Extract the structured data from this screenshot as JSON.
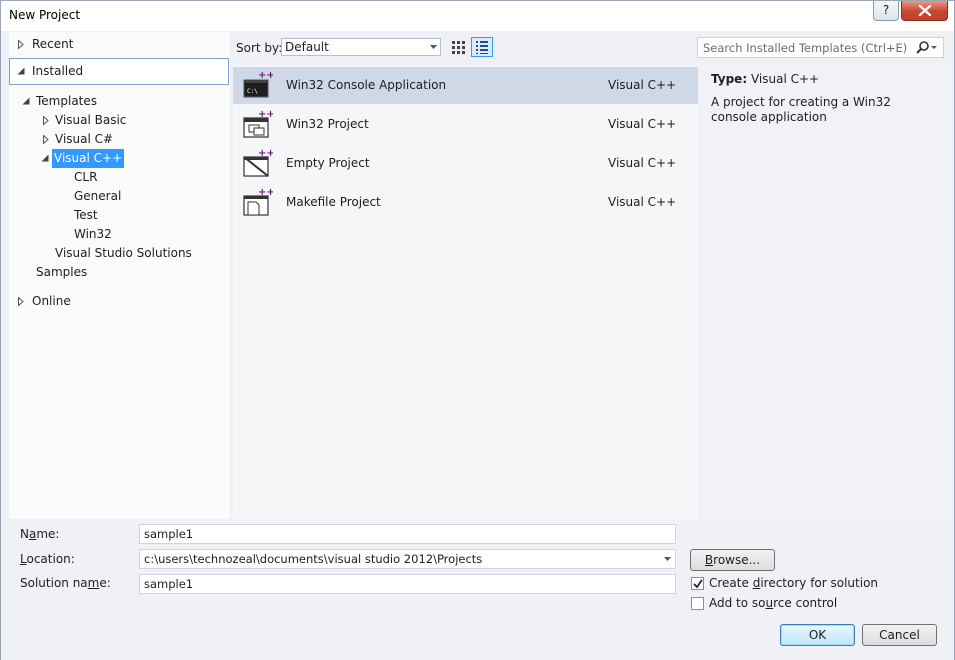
{
  "window": {
    "title": "New Project",
    "help_label": "?"
  },
  "tree": {
    "recent": "Recent",
    "installed": "Installed",
    "templates": "Templates",
    "visual_basic": "Visual Basic",
    "visual_csharp": "Visual C#",
    "visual_cpp": "Visual C++",
    "cpp_children": [
      "CLR",
      "General",
      "Test",
      "Win32"
    ],
    "vs_solutions": "Visual Studio Solutions",
    "samples": "Samples",
    "online": "Online"
  },
  "sort": {
    "label": "Sort by:",
    "value": "Default"
  },
  "search": {
    "placeholder": "Search Installed Templates (Ctrl+E)"
  },
  "templates": [
    {
      "name": "Win32 Console Application",
      "language": "Visual C++",
      "icon": "console-app-icon"
    },
    {
      "name": "Win32 Project",
      "language": "Visual C++",
      "icon": "win32-project-icon"
    },
    {
      "name": "Empty Project",
      "language": "Visual C++",
      "icon": "empty-project-icon"
    },
    {
      "name": "Makefile Project",
      "language": "Visual C++",
      "icon": "makefile-project-icon"
    }
  ],
  "details": {
    "type_label": "Type:",
    "type_value": "Visual C++",
    "description": "A project for creating a Win32 console application"
  },
  "form": {
    "name_label_pre": "N",
    "name_label_acc": "a",
    "name_label_post": "me:",
    "name_value": "sample1",
    "location_label_pre": "",
    "location_label_acc": "L",
    "location_label_post": "ocation:",
    "location_value": "c:\\users\\technozeal\\documents\\visual studio 2012\\Projects",
    "solution_label_pre": "Solution na",
    "solution_label_acc": "m",
    "solution_label_post": "e:",
    "solution_value": "sample1",
    "browse_pre": "",
    "browse_acc": "B",
    "browse_post": "rowse...",
    "create_dir_pre": "Create ",
    "create_dir_acc": "d",
    "create_dir_post": "irectory for solution",
    "create_dir_checked": true,
    "source_ctrl_pre": "Add to so",
    "source_ctrl_acc": "u",
    "source_ctrl_post": "rce control",
    "source_ctrl_checked": false,
    "ok_label": "OK",
    "cancel_label": "Cancel"
  },
  "colors": {
    "selection": "#3399ff",
    "selected_row": "#cfd8e6",
    "accent_purple": "#68217a"
  }
}
